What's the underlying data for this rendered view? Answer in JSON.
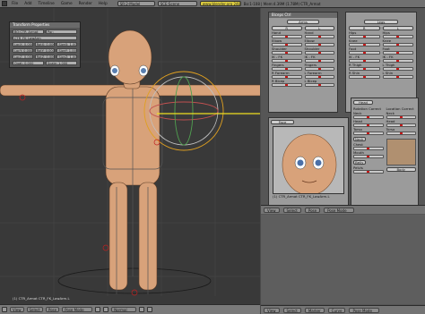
{
  "menubar": {
    "items": [
      "File",
      "Add",
      "Timeline",
      "Game",
      "Render",
      "Help"
    ],
    "screen_field": "SR:2-Model",
    "scene_field": "SCE:Scene",
    "url": "www.blender.org 248",
    "stats": "Bo:1-108 | Mem:4.39M (1.78M) CTR_Armat"
  },
  "transform_panel": {
    "title": "Transform Properties",
    "bone_name": "BO:CTR_Armat",
    "parent_name": "Par:",
    "rows": [
      [
        "LocX: 0.000",
        "RotX: 0.000",
        "SizeX: 1.000"
      ],
      [
        "LocY: 0.000",
        "RotY: 0.000",
        "SizeY: 1.000"
      ],
      [
        "LocZ: 0.000",
        "RotZ: 0.000",
        "SizeZ: 1.000"
      ],
      [
        "Quat: 0.000",
        "",
        "Scale: 1.000"
      ]
    ],
    "alt_fields": [
      "CTR_FK_LowArm"
    ]
  },
  "viewport": {
    "label": "(1) CTR_Armat CTR_FK_LowArm.L",
    "header": [
      "View",
      "Select",
      "Pose"
    ],
    "mode": "Pose Mode",
    "pivot": "Normal"
  },
  "right_panel": {
    "arms_title": "Biceps Ctrl",
    "arms_tab": "Arms",
    "legs_tab": "Legs",
    "arm_col_left": [
      "R",
      "Hand",
      "Elbow",
      "Shoulder",
      "IK - FK",
      "Fingers",
      "Thumb",
      "Pin",
      "Pin",
      "R Forearm",
      "R Bicep",
      "R Hand"
    ],
    "arm_col_right": [
      "L",
      "Hand",
      "Elbow",
      "Shoulder",
      "IK - FK",
      "Fingers",
      "Thumb",
      "Pin",
      "Pin",
      "L Forearm",
      "L Bicep",
      "L Hand"
    ],
    "leg_col_left": [
      "R",
      "Hips",
      "Knee",
      "Foot",
      "IK - FK",
      "Pin",
      "R Thigh",
      "R Shin",
      "R Foot"
    ],
    "leg_col_right": [
      "L",
      "Hips",
      "Knee",
      "Foot",
      "IK - FK",
      "Pin",
      "L Thigh",
      "L Shin",
      "L Foot"
    ],
    "face_tab": "Face",
    "head_tab": "Head",
    "rotation_label": "Rotation Correct",
    "location_label": "Location Correct",
    "head_sliders": [
      "Neck",
      "Head",
      "Torso",
      "Chest",
      "Mouth",
      "Pelvis"
    ],
    "neck_tab": "Neck",
    "belly_tab": "Belly",
    "body_tab": "Body",
    "face_label": "(1) CTR_Armat CTR_FK_LowArm.L",
    "lower_header": [
      "View",
      "Select",
      "Pose"
    ],
    "lower_mode": "Pose Mode"
  },
  "bottom_right": {
    "header": [
      "View",
      "Select",
      "Marker",
      "Curve"
    ],
    "mode": "Pose Mode"
  }
}
